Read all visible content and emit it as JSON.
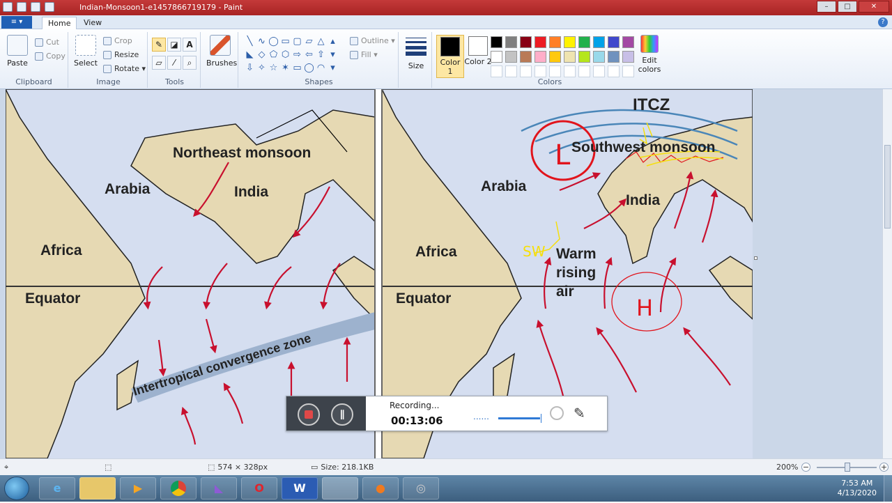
{
  "window": {
    "title": "Indian-Monsoon1-e1457866719179 - Paint",
    "controls": [
      "–",
      "□",
      "✕"
    ]
  },
  "tabs": {
    "file": "≡ ▾",
    "items": [
      "Home",
      "View"
    ],
    "help": "?"
  },
  "ribbon": {
    "clipboard": {
      "label": "Clipboard",
      "paste": "Paste",
      "cut": "Cut",
      "copy": "Copy"
    },
    "image": {
      "label": "Image",
      "select": "Select",
      "crop": "Crop",
      "resize": "Resize",
      "rotate": "Rotate ▾"
    },
    "tools": {
      "label": "Tools",
      "icons": [
        "pencil-icon",
        "fill-icon",
        "text-icon",
        "eraser-icon",
        "color-picker-icon",
        "magnifier-icon"
      ]
    },
    "brushes": {
      "label": "Brushes"
    },
    "shapes": {
      "label": "Shapes",
      "outline": "Outline ▾",
      "fill": "Fill ▾",
      "glyphs": [
        "╲",
        "∿",
        "◯",
        "▭",
        "▢",
        "▱",
        "△",
        "▴",
        "◣",
        "◇",
        "⬠",
        "⬡",
        "⇨",
        "⇦",
        "⇧",
        "▾",
        "⇩",
        "✧",
        "☆",
        "✶",
        "▭",
        "◯",
        "◠",
        "▾"
      ]
    },
    "size": {
      "label": "Size"
    },
    "colors": {
      "label": "Colors",
      "color1": "Color 1",
      "color2": "Color 2",
      "edit": "Edit colors",
      "color1_value": "#000000",
      "color2_value": "#ffffff",
      "palette": [
        "#000000",
        "#7f7f7f",
        "#880015",
        "#ed1c24",
        "#ff7f27",
        "#fff200",
        "#22b14c",
        "#00a2e8",
        "#3f48cc",
        "#a349a4",
        "#ffffff",
        "#c3c3c3",
        "#b97a57",
        "#ffaec9",
        "#ffc90e",
        "#efe4b0",
        "#b5e61d",
        "#99d9ea",
        "#7092be",
        "#c8bfe7",
        "",
        "",
        "",
        "",
        "",
        "",
        "",
        "",
        "",
        ""
      ]
    }
  },
  "map": {
    "left_panel": {
      "labels": {
        "northeast": "Northeast monsoon",
        "arabia": "Arabia",
        "india": "India",
        "africa": "Africa",
        "equator": "Equator",
        "itcz_band": "Intertropical  convergence zone"
      }
    },
    "right_panel": {
      "labels": {
        "itcz": "ITCZ",
        "southwest": "Southwest monsoon",
        "arabia": "Arabia",
        "india": "India",
        "africa": "Africa",
        "equator": "Equator",
        "warm1": "Warm",
        "warm2": "rising",
        "warm3": "air"
      },
      "annotations": {
        "low": "L",
        "high": "H",
        "sw": "SW"
      }
    }
  },
  "recorder": {
    "status": "Recording...",
    "time": "00:13:06",
    "dots": "......"
  },
  "statusbar": {
    "dimensions": "574 × 328px",
    "size": "Size: 218.1KB",
    "zoom": "200%"
  },
  "taskbar": {
    "apps": [
      "ie-icon",
      "explorer-icon",
      "media-player-icon",
      "chrome-icon",
      "visual-studio-icon",
      "opera-icon",
      "word-icon",
      "paint-icon",
      "recorder-icon",
      "cd-icon"
    ],
    "word_glyph": "W",
    "time": "7:53 AM",
    "date": "4/13/2020"
  }
}
